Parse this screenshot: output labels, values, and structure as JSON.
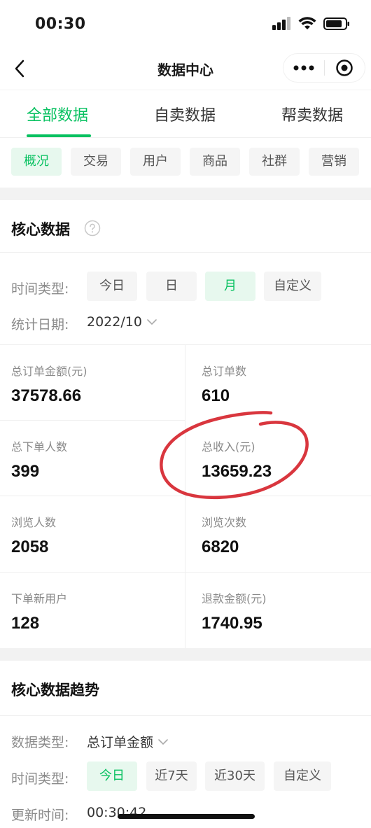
{
  "status_bar": {
    "time": "00:30"
  },
  "nav": {
    "title": "数据中心"
  },
  "tabs": [
    {
      "label": "全部数据",
      "active": true
    },
    {
      "label": "自卖数据",
      "active": false
    },
    {
      "label": "帮卖数据",
      "active": false
    }
  ],
  "subtabs": [
    {
      "label": "概况",
      "active": true
    },
    {
      "label": "交易",
      "active": false
    },
    {
      "label": "用户",
      "active": false
    },
    {
      "label": "商品",
      "active": false
    },
    {
      "label": "社群",
      "active": false
    },
    {
      "label": "营销",
      "active": false
    }
  ],
  "core": {
    "title": "核心数据",
    "time_type_label": "时间类型:",
    "time_types": [
      {
        "label": "今日",
        "active": false
      },
      {
        "label": "日",
        "active": false
      },
      {
        "label": "月",
        "active": true
      },
      {
        "label": "自定义",
        "active": false
      }
    ],
    "date_label": "统计日期:",
    "date_value": "2022/10",
    "metrics": [
      {
        "label": "总订单金额(元)",
        "value": "37578.66"
      },
      {
        "label": "总订单数",
        "value": "610"
      },
      {
        "label": "总下单人数",
        "value": "399"
      },
      {
        "label": "总收入(元)",
        "value": "13659.23"
      },
      {
        "label": "浏览人数",
        "value": "2058"
      },
      {
        "label": "浏览次数",
        "value": "6820"
      },
      {
        "label": "下单新用户",
        "value": "128"
      },
      {
        "label": "退款金额(元)",
        "value": "1740.95"
      }
    ]
  },
  "trend": {
    "title": "核心数据趋势",
    "data_type_label": "数据类型:",
    "data_type_value": "总订单金额",
    "time_type_label": "时间类型:",
    "time_types": [
      {
        "label": "今日",
        "active": true
      },
      {
        "label": "近7天",
        "active": false
      },
      {
        "label": "近30天",
        "active": false
      },
      {
        "label": "自定义",
        "active": false
      }
    ],
    "update_label": "更新时间:",
    "update_value": "00:30:42"
  },
  "colors": {
    "accent": "#07c160",
    "accent_bg": "#e7f8ee",
    "annotation": "#d9363e"
  }
}
